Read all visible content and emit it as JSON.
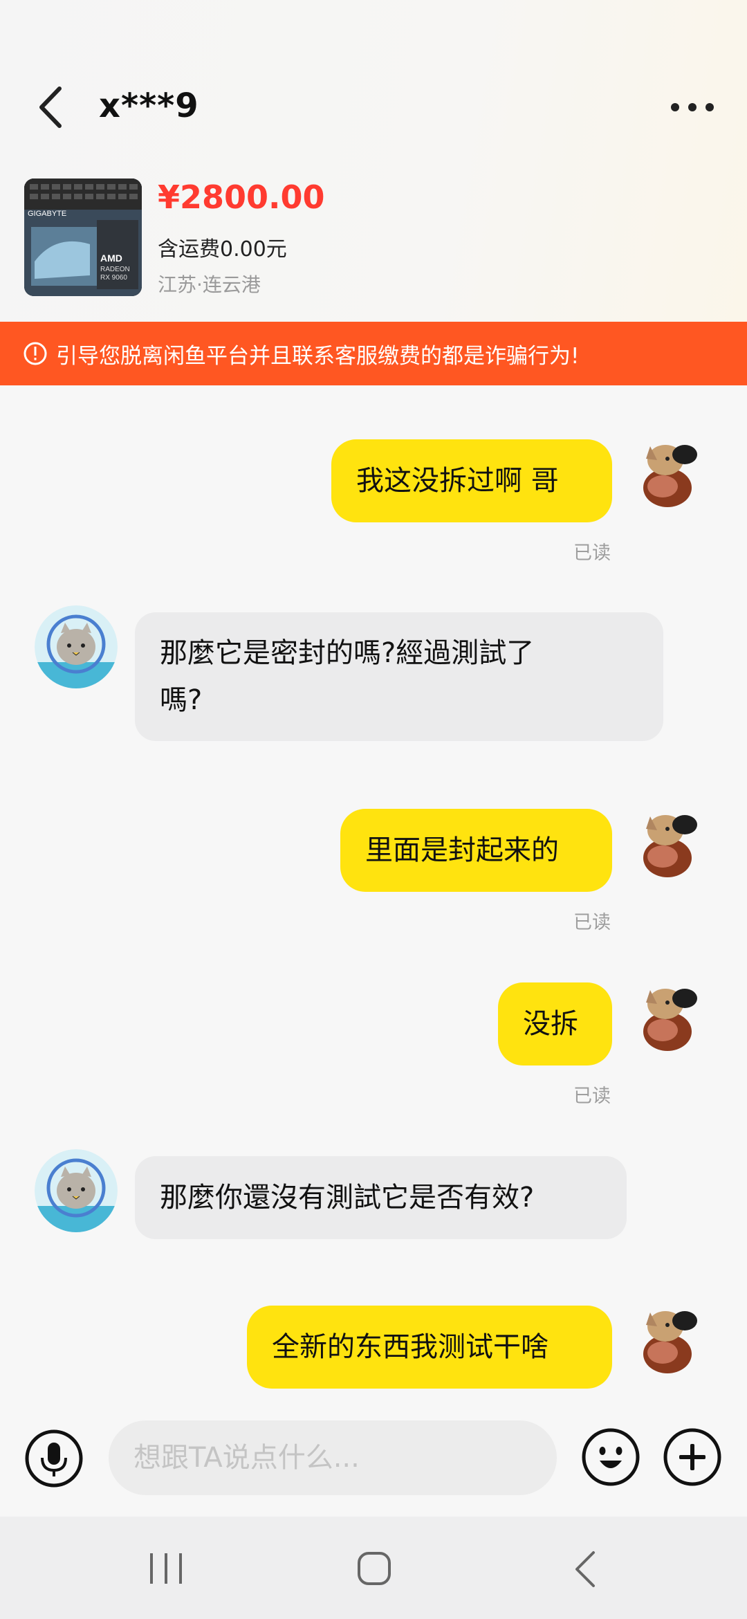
{
  "header": {
    "title": "x***9"
  },
  "product": {
    "price": "¥2800.00",
    "shipping": "含运费0.00元",
    "location": "江苏·连云港",
    "thumb_brand": "GIGABYTE",
    "thumb_gpu_brand": "AMD",
    "thumb_gpu_line1": "RADEON",
    "thumb_gpu_line2": "RX 9060"
  },
  "warning": {
    "text": "引导您脱离闲鱼平台并且联系客服缴费的都是诈骗行为!"
  },
  "messages": [
    {
      "direction": "out",
      "text": "我这没拆过啊 哥",
      "status": "已读"
    },
    {
      "direction": "in",
      "line1": "那麼它是密封的嗎?經過測試了",
      "line2": "嗎?"
    },
    {
      "direction": "out",
      "text": "里面是封起来的",
      "status": "已读"
    },
    {
      "direction": "out",
      "text": "没拆",
      "status": "已读"
    },
    {
      "direction": "in",
      "text": "那麼你還沒有測試它是否有效?"
    },
    {
      "direction": "out",
      "text": "全新的东西我测试干啥"
    }
  ],
  "input": {
    "placeholder": "想跟TA说点什么..."
  },
  "colors": {
    "outgoing_bubble": "#ffe30f",
    "incoming_bubble": "#ebebec",
    "warning_bar": "#ff5722",
    "price": "#ff3b30"
  }
}
